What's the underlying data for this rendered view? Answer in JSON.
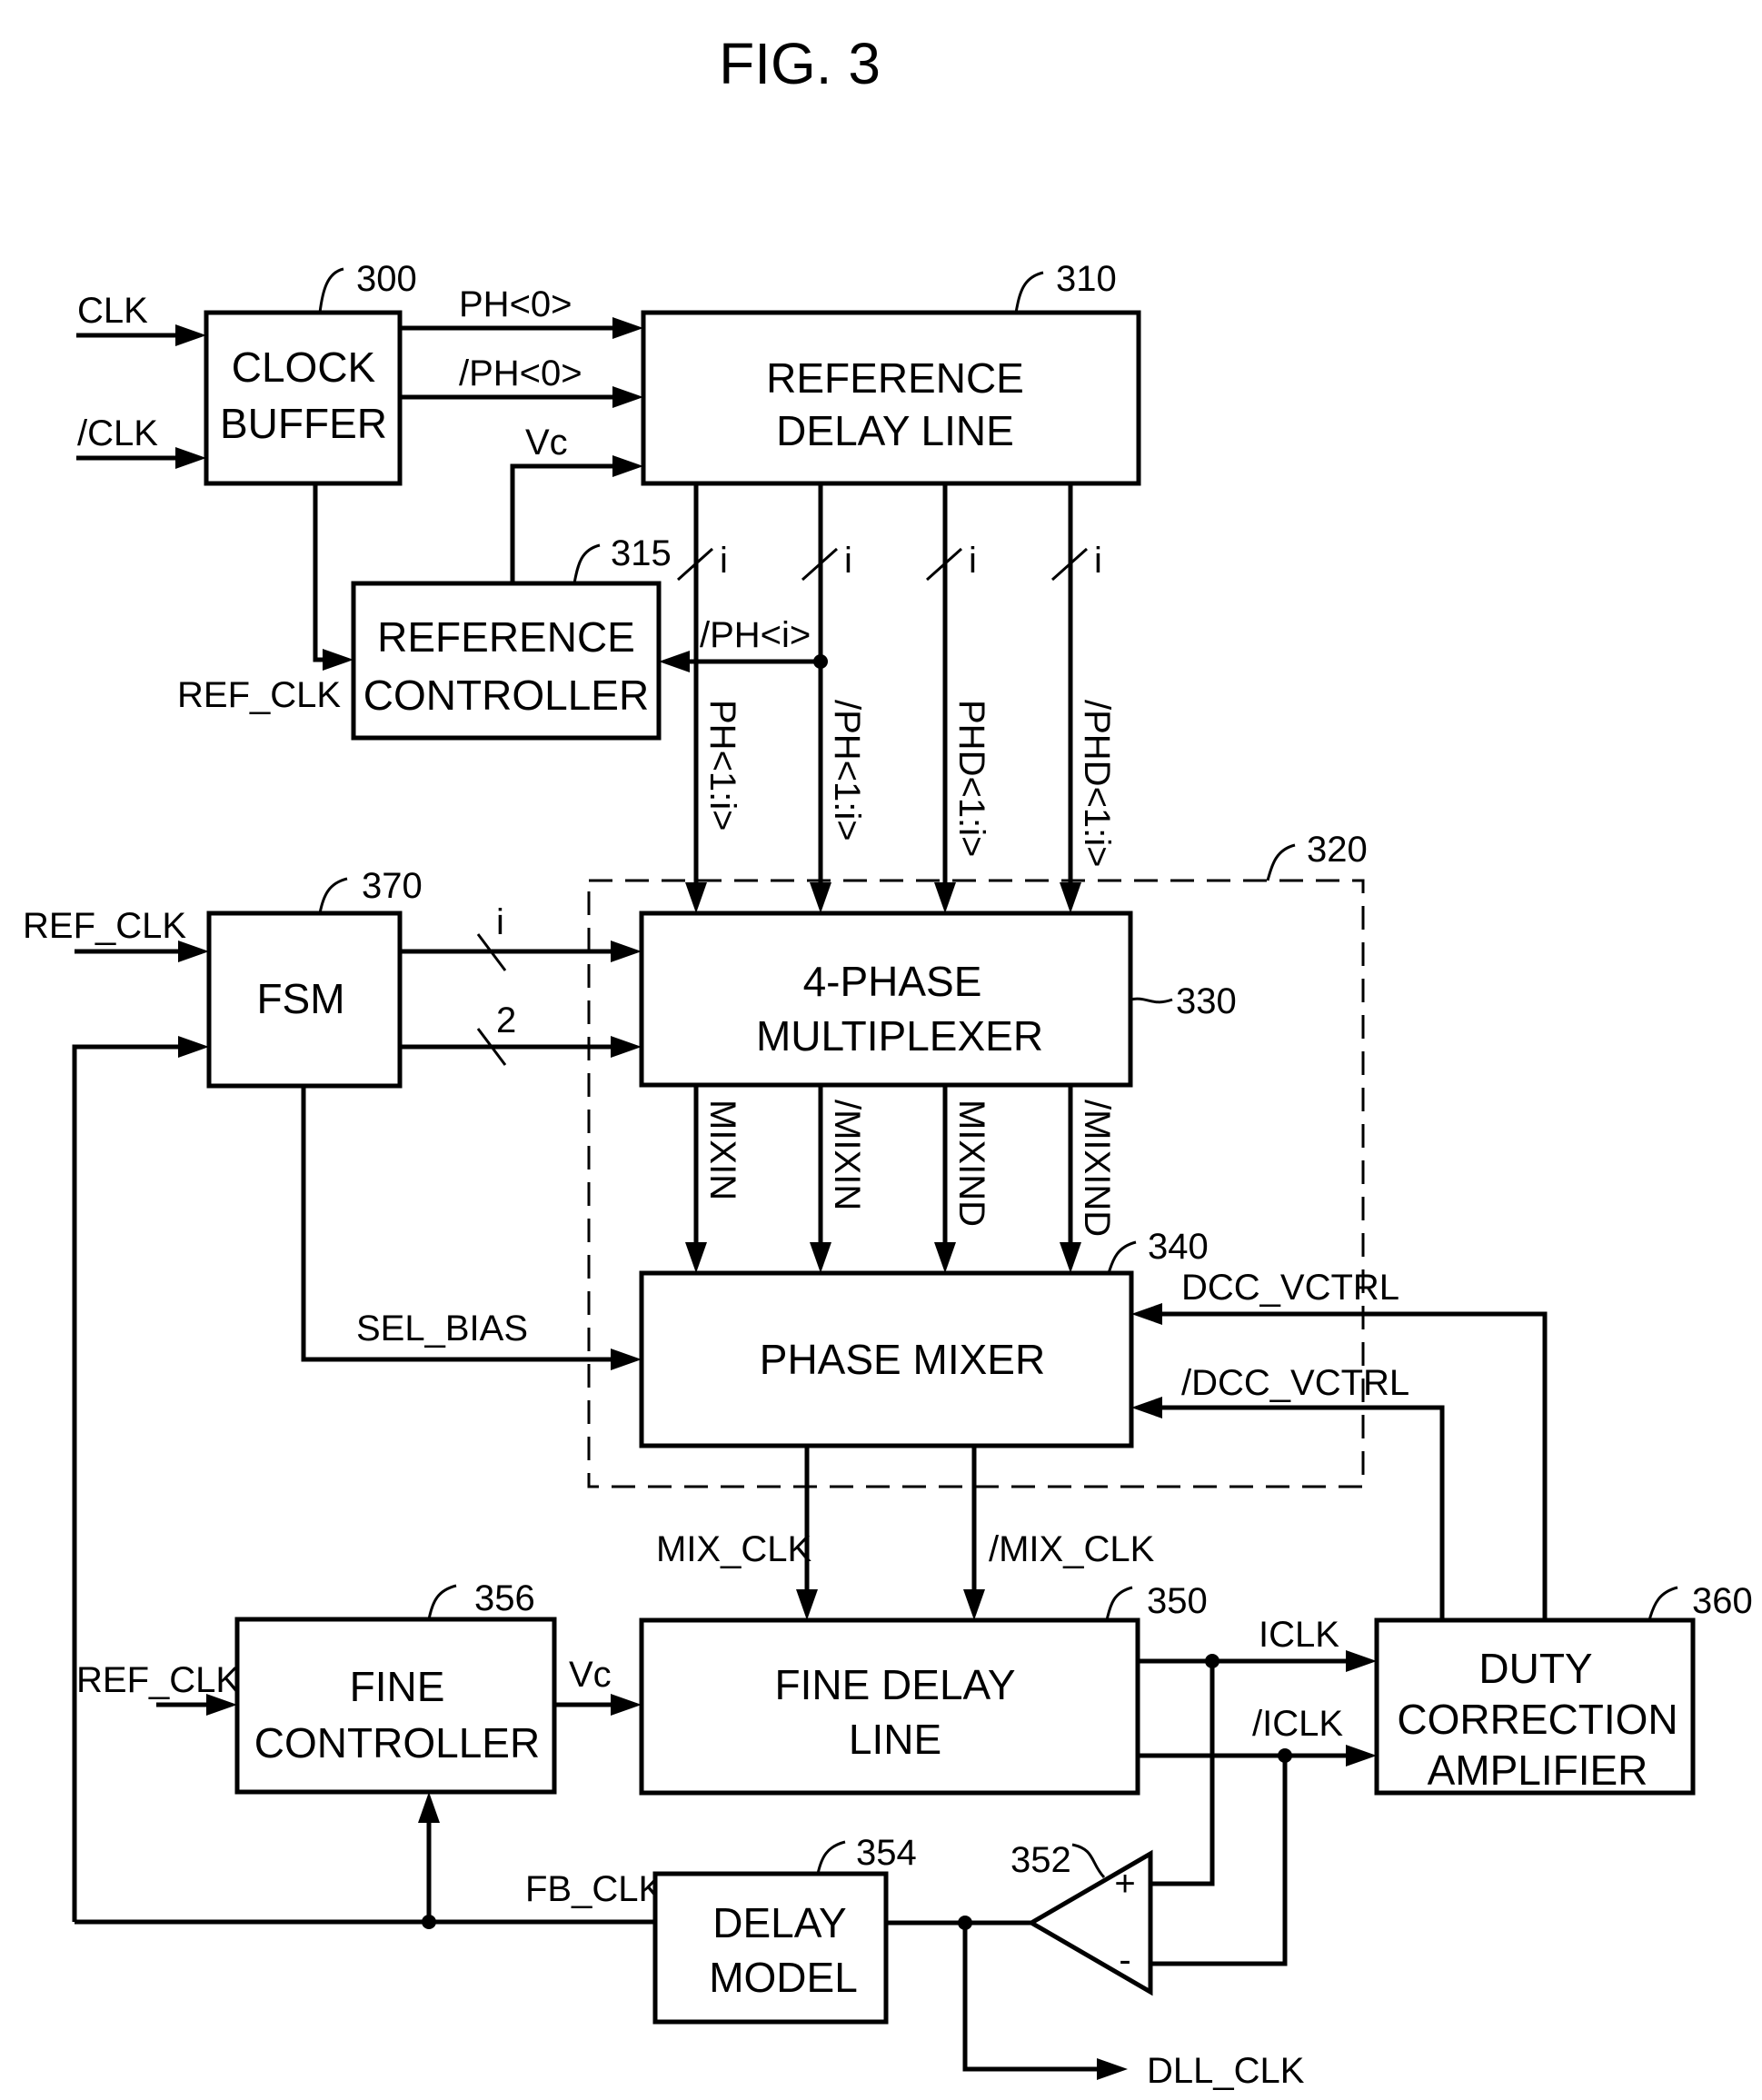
{
  "figure": {
    "title": "FIG. 3"
  },
  "blocks": {
    "clock_buffer": {
      "ref": "300",
      "line1": "CLOCK",
      "line2": "BUFFER"
    },
    "reference_delay_line": {
      "ref": "310",
      "line1": "REFERENCE",
      "line2": "DELAY LINE"
    },
    "reference_controller": {
      "ref": "315",
      "line1": "REFERENCE",
      "line2": "CONTROLLER"
    },
    "block_320": {
      "ref": "320"
    },
    "four_phase_mux": {
      "ref": "330",
      "line1": "4-PHASE",
      "line2": "MULTIPLEXER"
    },
    "phase_mixer": {
      "ref": "340",
      "line1": "PHASE MIXER"
    },
    "fine_delay_line": {
      "ref": "350",
      "line1": "FINE DELAY",
      "line2": "LINE"
    },
    "comparator": {
      "ref": "352",
      "plus": "+",
      "minus": "-"
    },
    "delay_model": {
      "ref": "354",
      "line1": "DELAY",
      "line2": "MODEL"
    },
    "fine_controller": {
      "ref": "356",
      "line1": "FINE",
      "line2": "CONTROLLER"
    },
    "duty_correction_amplifier": {
      "ref": "360",
      "line1": "DUTY",
      "line2": "CORRECTION",
      "line3": "AMPLIFIER"
    },
    "fsm": {
      "ref": "370",
      "line1": "FSM"
    }
  },
  "signals": {
    "clk": "CLK",
    "clk_b": "/CLK",
    "ph0": "PH<0>",
    "ph0_b": "/PH<0>",
    "vc_top": "Vc",
    "ref_clk_top": "REF_CLK",
    "ph_i_b": "/PH<i>",
    "bus_width_i": "i",
    "ph_bus": "PH<1:i>",
    "ph_bus_b": "/PH<1:i>",
    "phd_bus": "PHD<1:i>",
    "phd_bus_b": "/PHD<1:i>",
    "ref_clk_fsm": "REF_CLK",
    "fsm_bus_i": "i",
    "fsm_bus_2": "2",
    "mixin": "MIXIN",
    "mixin_b": "/MIXIN",
    "mixind": "MIXIND",
    "mixind_b": "/MIXIND",
    "sel_bias": "SEL_BIAS",
    "dcc_vctrl": "DCC_VCTRL",
    "dcc_vctrl_b": "/DCC_VCTRL",
    "mix_clk": "MIX_CLK",
    "mix_clk_b": "/MIX_CLK",
    "ref_clk_fine": "REF_CLK",
    "vc_fine": "Vc",
    "iclk": "ICLK",
    "iclk_b": "/ICLK",
    "fb_clk": "FB_CLK",
    "dll_clk": "DLL_CLK"
  }
}
